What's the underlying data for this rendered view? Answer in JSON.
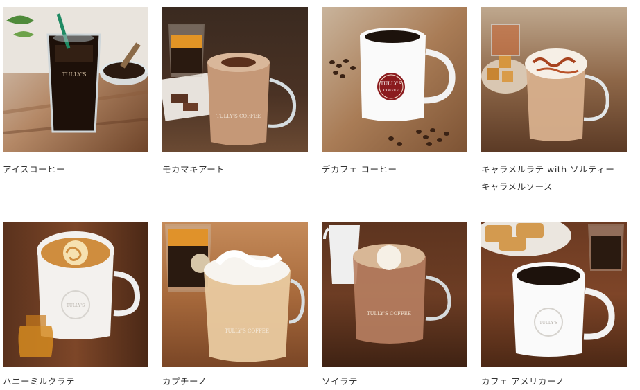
{
  "products": [
    {
      "name": "アイスコーヒー"
    },
    {
      "name": "モカマキアート"
    },
    {
      "name": "デカフェ コーヒー"
    },
    {
      "name": "キャラメルラテ with ソルティー\nキャラメルソース"
    },
    {
      "name": "ハニーミルクラテ"
    },
    {
      "name": "カプチーノ"
    },
    {
      "name": "ソイラテ"
    },
    {
      "name": "カフェ アメリカーノ"
    }
  ]
}
